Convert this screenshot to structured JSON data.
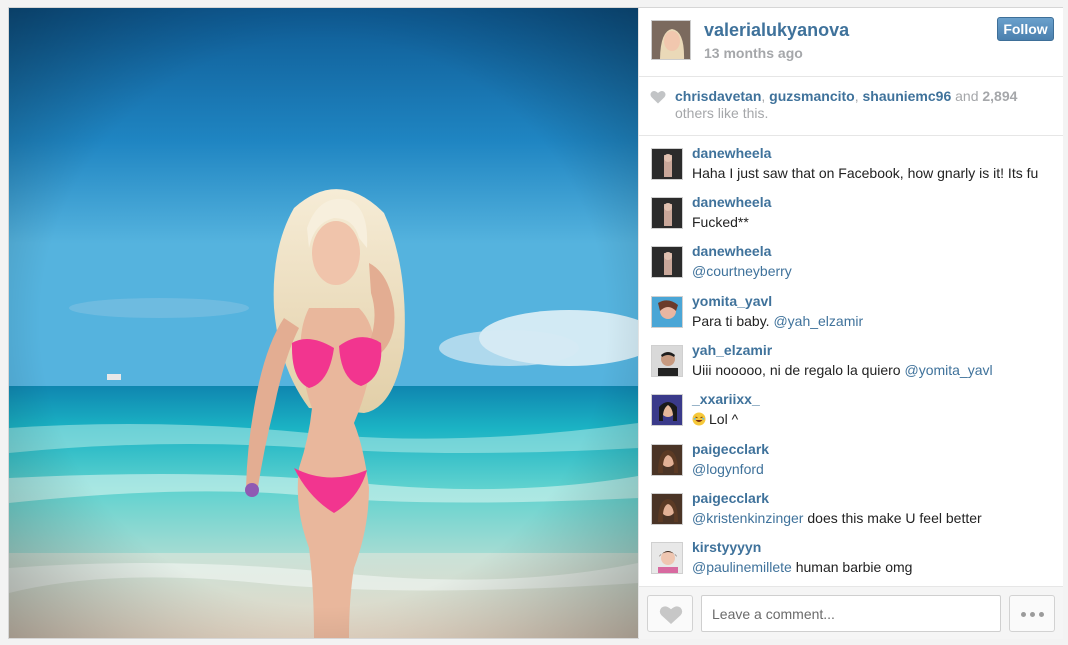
{
  "post": {
    "username": "valerialukyanova",
    "time_ago": "13 months ago",
    "follow_label": "Follow"
  },
  "likes": {
    "users": [
      "chrisdavetan",
      "guzsmancito",
      "shauniemc96"
    ],
    "sep1": ", ",
    "sep2": ", ",
    "and_text": " and ",
    "count": "2,894",
    "suffix": " others like this."
  },
  "comments": [
    {
      "user": "danewheela",
      "text": "Haha I just saw that on Facebook, how gnarly is it! Its fu",
      "mention": "",
      "after": ""
    },
    {
      "user": "danewheela",
      "text": "Fucked**",
      "mention": "",
      "after": ""
    },
    {
      "user": "danewheela",
      "text": "",
      "mention": "@courtneyberry",
      "after": ""
    },
    {
      "user": "yomita_yavl",
      "text": "Para ti baby. ",
      "mention": "@yah_elzamir",
      "after": ""
    },
    {
      "user": "yah_elzamir",
      "text": "Uiii nooooo, ni de regalo la quiero ",
      "mention": "@yomita_yavl",
      "after": ""
    },
    {
      "user": "_xxariixx_",
      "text": "Lol ^",
      "mention": "",
      "after": ""
    },
    {
      "user": "paigecclark",
      "text": "",
      "mention": "@logynford",
      "after": ""
    },
    {
      "user": "paigecclark",
      "text": "",
      "mention": "@kristenkinzinger",
      "after": " does this make U feel better"
    },
    {
      "user": "kirstyyyyn",
      "text": "",
      "mention": "@paulinemillete",
      "after": " human barbie omg"
    }
  ],
  "comment_box": {
    "placeholder": "Leave a comment..."
  },
  "icons": {
    "heart": "heart-icon",
    "more": "more-options-icon",
    "emoji": "laughing-emoji-icon"
  },
  "colors": {
    "link": "#3f729b",
    "muted": "#a5a7aa",
    "follow": "#4b80ae"
  }
}
